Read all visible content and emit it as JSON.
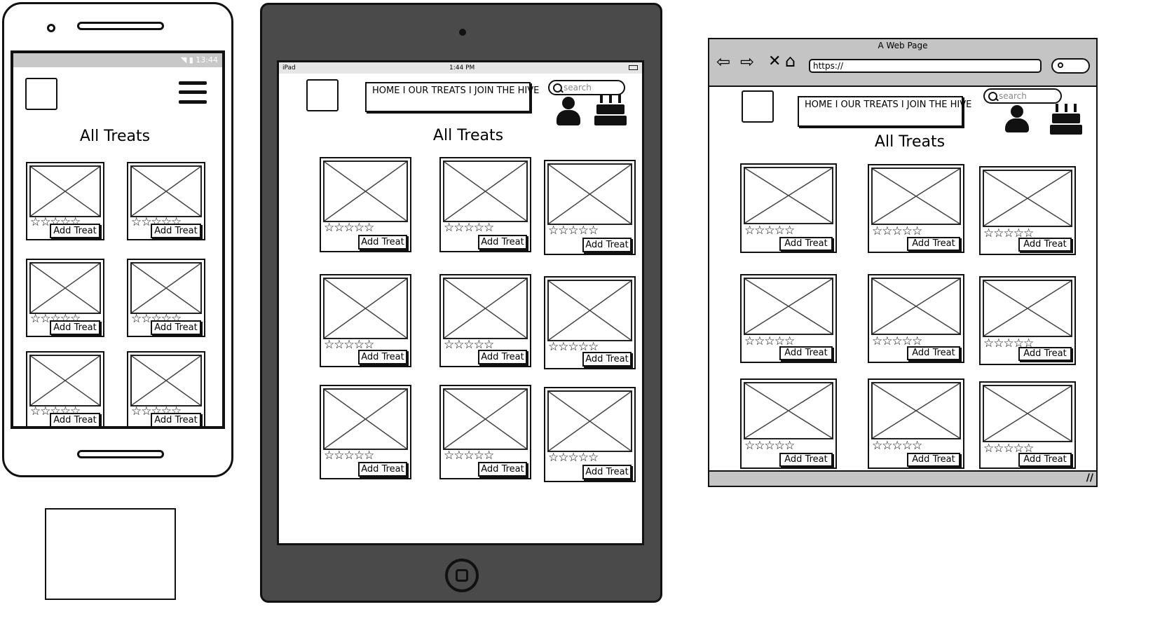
{
  "heading": "All Treats",
  "add_button_label": "Add Treat",
  "rating_stars": "☆☆☆☆☆",
  "nav_links": "HOME I OUR TREATS I JOIN THE HIVE",
  "search_placeholder": "search",
  "phone": {
    "status_time": "13:44"
  },
  "tablet": {
    "status_device": "iPad",
    "status_time": "1:44 PM"
  },
  "browser": {
    "window_title": "A Web Page",
    "url": "https://"
  },
  "icons": {
    "menu": "hamburger-menu-icon",
    "user": "user-icon",
    "cake": "birthday-cake-icon",
    "placeholder": "image-placeholder-icon"
  }
}
